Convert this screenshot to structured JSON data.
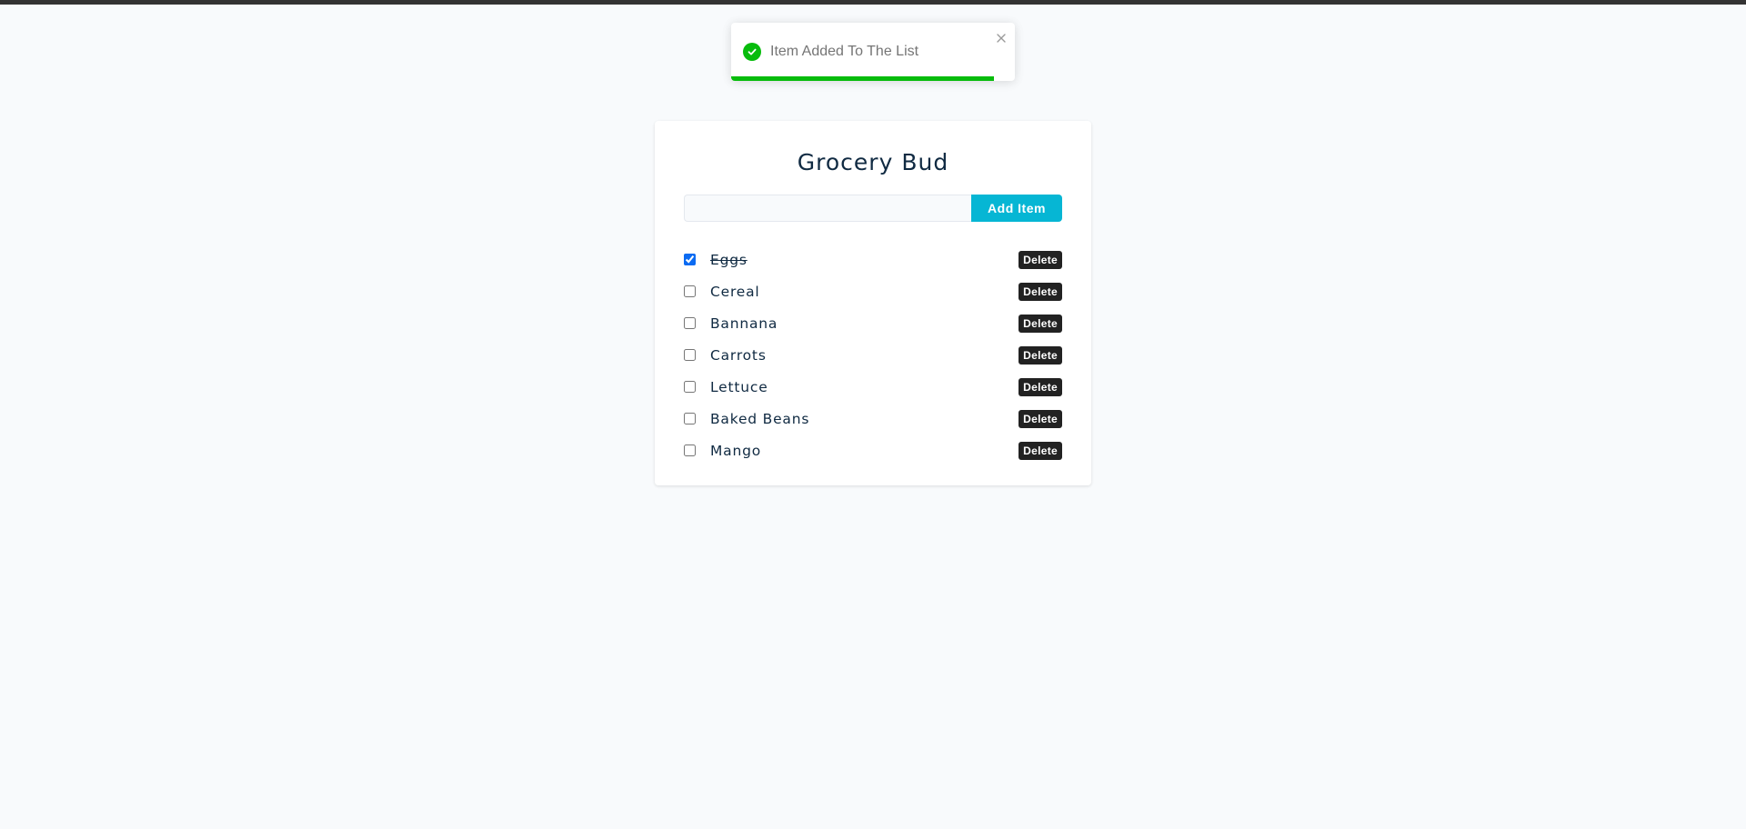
{
  "toast": {
    "message": "Item Added To The List",
    "status_color": "#07bc0c",
    "icon": "check-circle-icon",
    "close_icon": "close-icon",
    "progress": 0.925
  },
  "app": {
    "title": "Grocery Bud"
  },
  "form": {
    "input_value": "",
    "input_placeholder": "",
    "submit_label": "Add Item",
    "accent_color": "#06b6d4"
  },
  "items": [
    {
      "name": "Eggs",
      "completed": true,
      "delete_label": "Delete"
    },
    {
      "name": "Cereal",
      "completed": false,
      "delete_label": "Delete"
    },
    {
      "name": "Bannana",
      "completed": false,
      "delete_label": "Delete"
    },
    {
      "name": "Carrots",
      "completed": false,
      "delete_label": "Delete"
    },
    {
      "name": "Lettuce",
      "completed": false,
      "delete_label": "Delete"
    },
    {
      "name": "Baked Beans",
      "completed": false,
      "delete_label": "Delete"
    },
    {
      "name": "Mango",
      "completed": false,
      "delete_label": "Delete"
    }
  ]
}
